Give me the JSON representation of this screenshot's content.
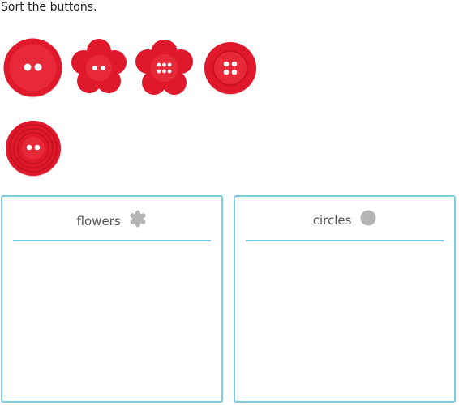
{
  "prompt": "Sort the buttons.",
  "button_color": "#e0182b",
  "buttons": [
    {
      "shape": "circle",
      "holes": 2
    },
    {
      "shape": "flower",
      "holes": 2
    },
    {
      "shape": "flower",
      "holes": 6
    },
    {
      "shape": "circle",
      "holes": 4
    },
    {
      "shape": "circle",
      "holes": 2
    }
  ],
  "bins": [
    {
      "label": "flowers",
      "icon": "flower-icon"
    },
    {
      "label": "circles",
      "icon": "circle-icon"
    }
  ],
  "colors": {
    "bin_border": "#7ccde3",
    "icon_gray": "#b4b4b4"
  }
}
